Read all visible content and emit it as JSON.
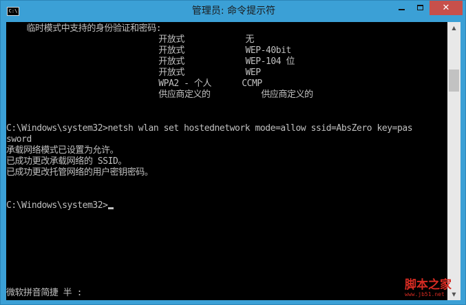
{
  "window": {
    "title": "管理员: 命令提示符",
    "icon_label": "C:\\",
    "close_glyph": "✕"
  },
  "console": {
    "lines": [
      "    临时模式中支持的身份验证和密码:",
      "                              开放式            无",
      "                              开放式            WEP-40bit",
      "                              开放式            WEP-104 位",
      "                              开放式            WEP",
      "                              WPA2 - 个人      CCMP",
      "                              供应商定义的          供应商定义的",
      "",
      "C:\\Windows\\system32>netsh wlan set hostednetwork mode=allow ssid=AbsZero key=pas",
      "sword",
      "承载网络模式已设置为允许。",
      "已成功更改承载网络的 SSID。",
      "已成功更改托管网络的用户密钥密码。",
      "",
      "",
      "C:\\Windows\\system32>"
    ],
    "ime_status": "微软拼音简捷 半 :"
  },
  "watermark": {
    "text": "脚本之家",
    "url": "www.jb51.net"
  }
}
